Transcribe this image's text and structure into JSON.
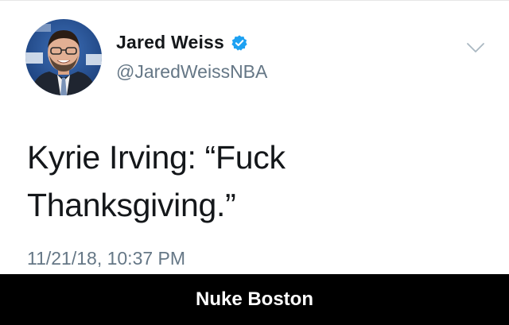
{
  "tweet": {
    "display_name": "Jared Weiss",
    "handle": "@JaredWeissNBA",
    "text_line1": "Kyrie Irving: “Fuck",
    "text_line2": "Thanksgiving.”",
    "timestamp": "11/21/18, 10:37 PM",
    "verified_icon": "verified-badge-icon",
    "menu_icon": "chevron-down-icon"
  },
  "caption": {
    "text": "Nuke Boston"
  },
  "colors": {
    "name_text": "#14171a",
    "secondary_text": "#657786",
    "verified_blue": "#1da1f2",
    "caption_bg": "#000000",
    "caption_text": "#ffffff"
  }
}
